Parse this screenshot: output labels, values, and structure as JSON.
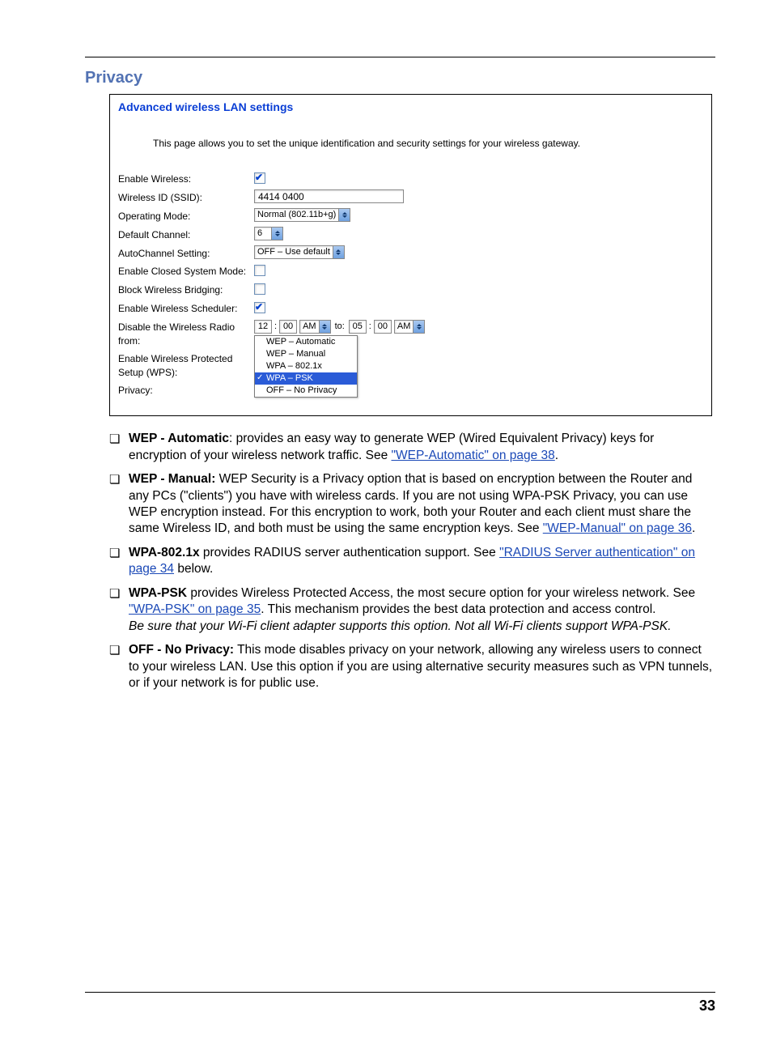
{
  "heading": "Privacy",
  "panel": {
    "title": "Advanced wireless LAN settings",
    "intro": "This page allows you to set the unique identification and security settings for your wireless gateway.",
    "rows": {
      "enable_wireless": {
        "label": "Enable Wireless:",
        "checked": true
      },
      "ssid": {
        "label": "Wireless ID (SSID):",
        "value": "4414 0400"
      },
      "op_mode": {
        "label": "Operating Mode:",
        "value": "Normal (802.11b+g)"
      },
      "channel": {
        "label": "Default Channel:",
        "value": "6"
      },
      "autochannel": {
        "label": "AutoChannel Setting:",
        "value": "OFF – Use default"
      },
      "closed_mode": {
        "label": "Enable Closed System Mode:",
        "checked": false
      },
      "block_bridging": {
        "label": "Block Wireless Bridging:",
        "checked": false
      },
      "scheduler": {
        "label": "Enable Wireless Scheduler:",
        "checked": true
      },
      "radio_from": {
        "label": "Disable the Wireless Radio from:",
        "h1": "12",
        "m1": "00",
        "ampm1": "AM",
        "sep": "to:",
        "h2": "05",
        "m2": "00",
        "ampm2": "AM"
      },
      "wps": {
        "label": "Enable Wireless Protected Setup (WPS):"
      },
      "privacy": {
        "label": "Privacy:"
      }
    },
    "menu": [
      {
        "text": "WEP – Automatic",
        "selected": false
      },
      {
        "text": "WEP – Manual",
        "selected": false
      },
      {
        "text": "WPA – 802.1x",
        "selected": false
      },
      {
        "text": "WPA – PSK",
        "selected": true
      },
      {
        "text": "OFF – No Privacy",
        "selected": false
      }
    ]
  },
  "bullets": [
    {
      "bold": "WEP - Automatic",
      "text1": ": provides an easy way to generate WEP (Wired Equivalent Privacy) keys for encryption of your wireless network traffic. See ",
      "link": "\"WEP-Automatic\" on page 38",
      "text2": "."
    },
    {
      "bold": "WEP - Manual:",
      "text1": " WEP Security is a Privacy option that is based on encryption between the Router and any PCs (\"clients\") you have with wireless cards. If you are not using WPA-PSK Privacy, you can use WEP encryption instead. For this encryption to work, both your Router and each client must share the same Wireless ID, and both must be using the same encryption keys. See ",
      "link": "\"WEP-Manual\" on page 36",
      "text2": "."
    },
    {
      "bold": "WPA-802.1x",
      "text1": " provides RADIUS server authentication support. See ",
      "link": "\"RADIUS Server authentication\" on page 34",
      "text2": " below."
    },
    {
      "bold": "WPA-PSK",
      "text1": " provides Wireless Protected Access, the most secure option for your wireless network. See ",
      "link": "\"WPA-PSK\" on page 35",
      "text2": ". This mechanism provides the best data protection and access control.",
      "italic": "Be sure that your Wi-Fi client adapter supports this option. Not all Wi-Fi clients support WPA-PSK."
    },
    {
      "bold": "OFF - No Privacy:",
      "text1": " This mode disables privacy on your network, allowing any wireless users to connect to your wireless LAN. Use this option if you are using alternative security measures such as VPN tunnels, or if your network is for public use."
    }
  ],
  "page_number": "33"
}
